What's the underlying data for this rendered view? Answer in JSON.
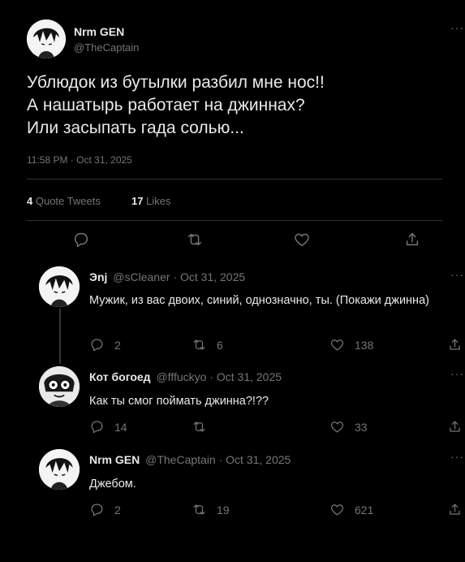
{
  "main_tweet": {
    "author_name": "Nrm GEN",
    "author_handle": "@TheCaptain",
    "text_lines": [
      "Ублюдок из бутылки разбил мне нос!!",
      "А нашатырь работает на джиннах?",
      "Или засыпать гада солью..."
    ],
    "timestamp": "11:58 PM · Oct 31, 2025",
    "quote_tweets_count": "4",
    "quote_tweets_label": "Quote Tweets",
    "likes_count": "17",
    "likes_label": "Likes",
    "more": "···"
  },
  "replies": [
    {
      "author_name": "Эnj",
      "meta": "@sCleaner · Oct 31, 2025",
      "text": "Мужик, из вас двоих, синий, однозначно, ты. (Покажи джинна)",
      "replies": "2",
      "retweets": "6",
      "likes": "138",
      "more": "···"
    },
    {
      "author_name": "Кот богоед",
      "meta": "@fffuckyo · Oct 31, 2025",
      "text": "Как ты смог поймать джинна?!??",
      "replies": "14",
      "retweets": "",
      "likes": "33",
      "more": "···"
    },
    {
      "author_name": "Nrm GEN",
      "meta": "@TheCaptain · Oct 31, 2025",
      "text": "Джебом.",
      "replies": "2",
      "retweets": "19",
      "likes": "621",
      "more": "···"
    }
  ],
  "icons": {
    "reply": "reply-icon",
    "retweet": "retweet-icon",
    "like": "like-icon",
    "share": "share-icon"
  }
}
